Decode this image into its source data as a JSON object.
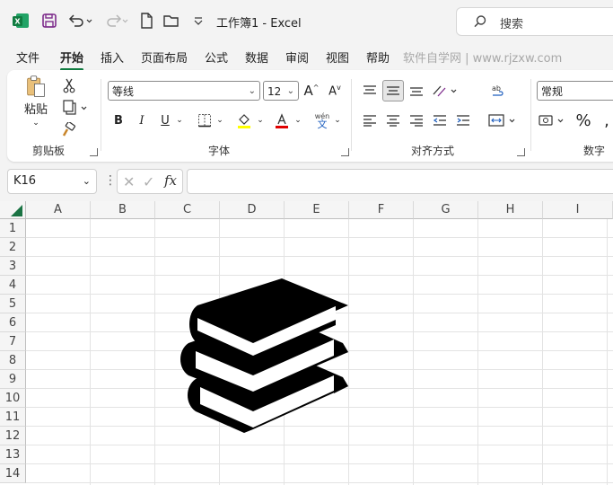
{
  "titlebar": {
    "title": "工作簿1  -  Excel",
    "search_placeholder": "搜索"
  },
  "tabs": [
    {
      "label": "文件"
    },
    {
      "label": "开始"
    },
    {
      "label": "插入"
    },
    {
      "label": "页面布局"
    },
    {
      "label": "公式"
    },
    {
      "label": "数据"
    },
    {
      "label": "审阅"
    },
    {
      "label": "视图"
    },
    {
      "label": "帮助"
    }
  ],
  "active_tab": "开始",
  "watermark": "软件自学网 | www.rjzxw.com",
  "ribbon": {
    "clipboard": {
      "paste_label": "粘贴",
      "group_label": "剪贴板"
    },
    "font": {
      "font_name": "等线",
      "font_size": "12",
      "bold": "B",
      "italic": "I",
      "underline": "U",
      "group_label": "字体",
      "phonetic_top": "wén",
      "phonetic_bottom": "文"
    },
    "alignment": {
      "group_label": "对齐方式"
    },
    "number": {
      "format": "常规",
      "group_label": "数字",
      "percent": "%"
    }
  },
  "formula_bar": {
    "name_box": "K16",
    "fx_label": "fx",
    "formula": ""
  },
  "grid": {
    "columns": [
      "A",
      "B",
      "C",
      "D",
      "E",
      "F",
      "G",
      "H",
      "I"
    ],
    "rows": [
      "1",
      "2",
      "3",
      "4",
      "5",
      "6",
      "7",
      "8",
      "9",
      "10",
      "11",
      "12",
      "13",
      "14"
    ]
  },
  "colors": {
    "accent": "#107c41",
    "excel_green": "#1d6f42"
  },
  "drawing": {
    "icon": "books-icon"
  }
}
